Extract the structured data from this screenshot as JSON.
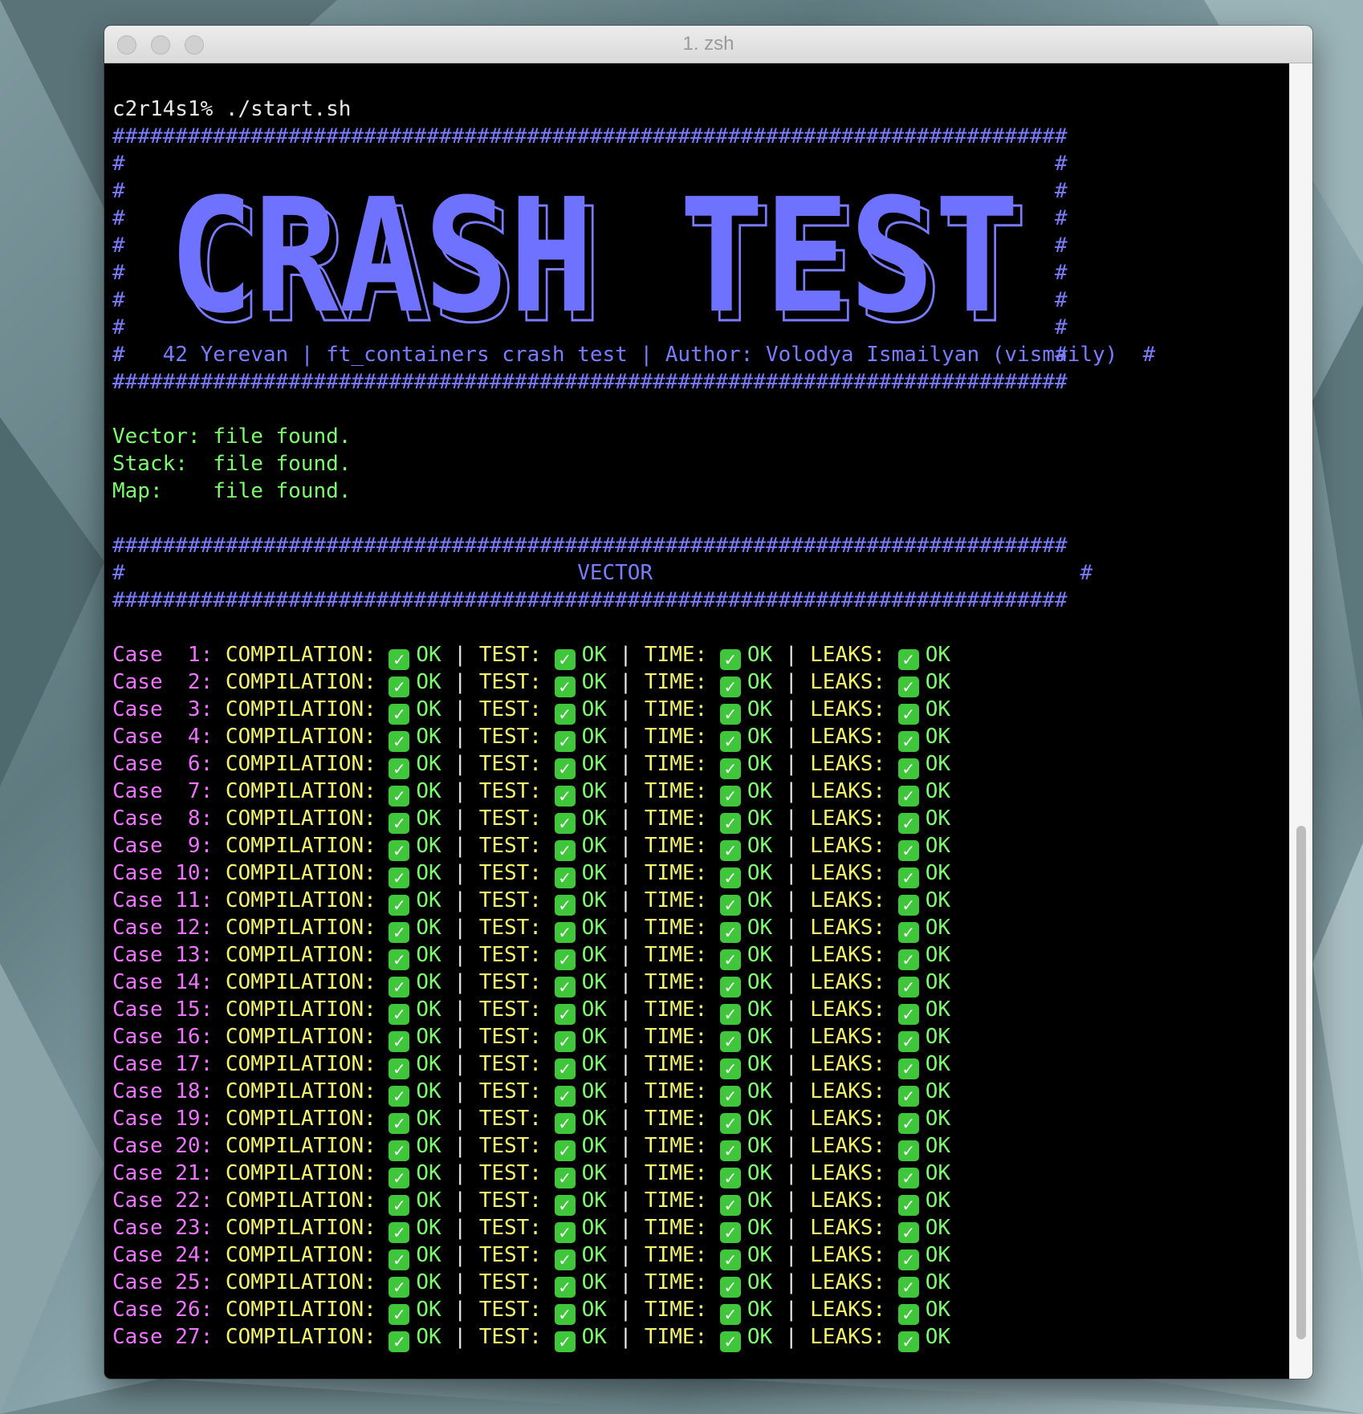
{
  "window": {
    "title": "1. zsh"
  },
  "prompt": {
    "text": "c2r14s1% ./start.sh"
  },
  "banner": {
    "hash_line": "############################################################################",
    "side_char": "#",
    "big_text": "CRASH TEST",
    "subtitle": "42 Yerevan | ft_containers crash test | Author: Volodya Ismailyan (vismaily)"
  },
  "files": [
    {
      "label": "Vector:",
      "status": "file found."
    },
    {
      "label": "Stack: ",
      "status": "file found."
    },
    {
      "label": "Map:   ",
      "status": "file found."
    }
  ],
  "section": {
    "title": "VECTOR"
  },
  "case_labels": {
    "case": "Case",
    "compilation": "COMPILATION:",
    "test": "TEST:",
    "time": "TIME:",
    "leaks": "LEAKS:",
    "ok": "OK",
    "sep": "|"
  },
  "cases": [
    " 1",
    " 2",
    " 3",
    " 4",
    " 6",
    " 7",
    " 8",
    " 9",
    "10",
    "11",
    "12",
    "13",
    "14",
    "15",
    "16",
    "17",
    "18",
    "19",
    "20",
    "21",
    "22",
    "23",
    "24",
    "25",
    "26",
    "27"
  ],
  "colors": {
    "banner": "#7a7cff",
    "ok": "#7dfc6f",
    "case": "#ee74ff",
    "label": "#f5f36b",
    "check_bg": "#3fc63a"
  },
  "icons": {
    "check": "white-check-mark-icon"
  }
}
